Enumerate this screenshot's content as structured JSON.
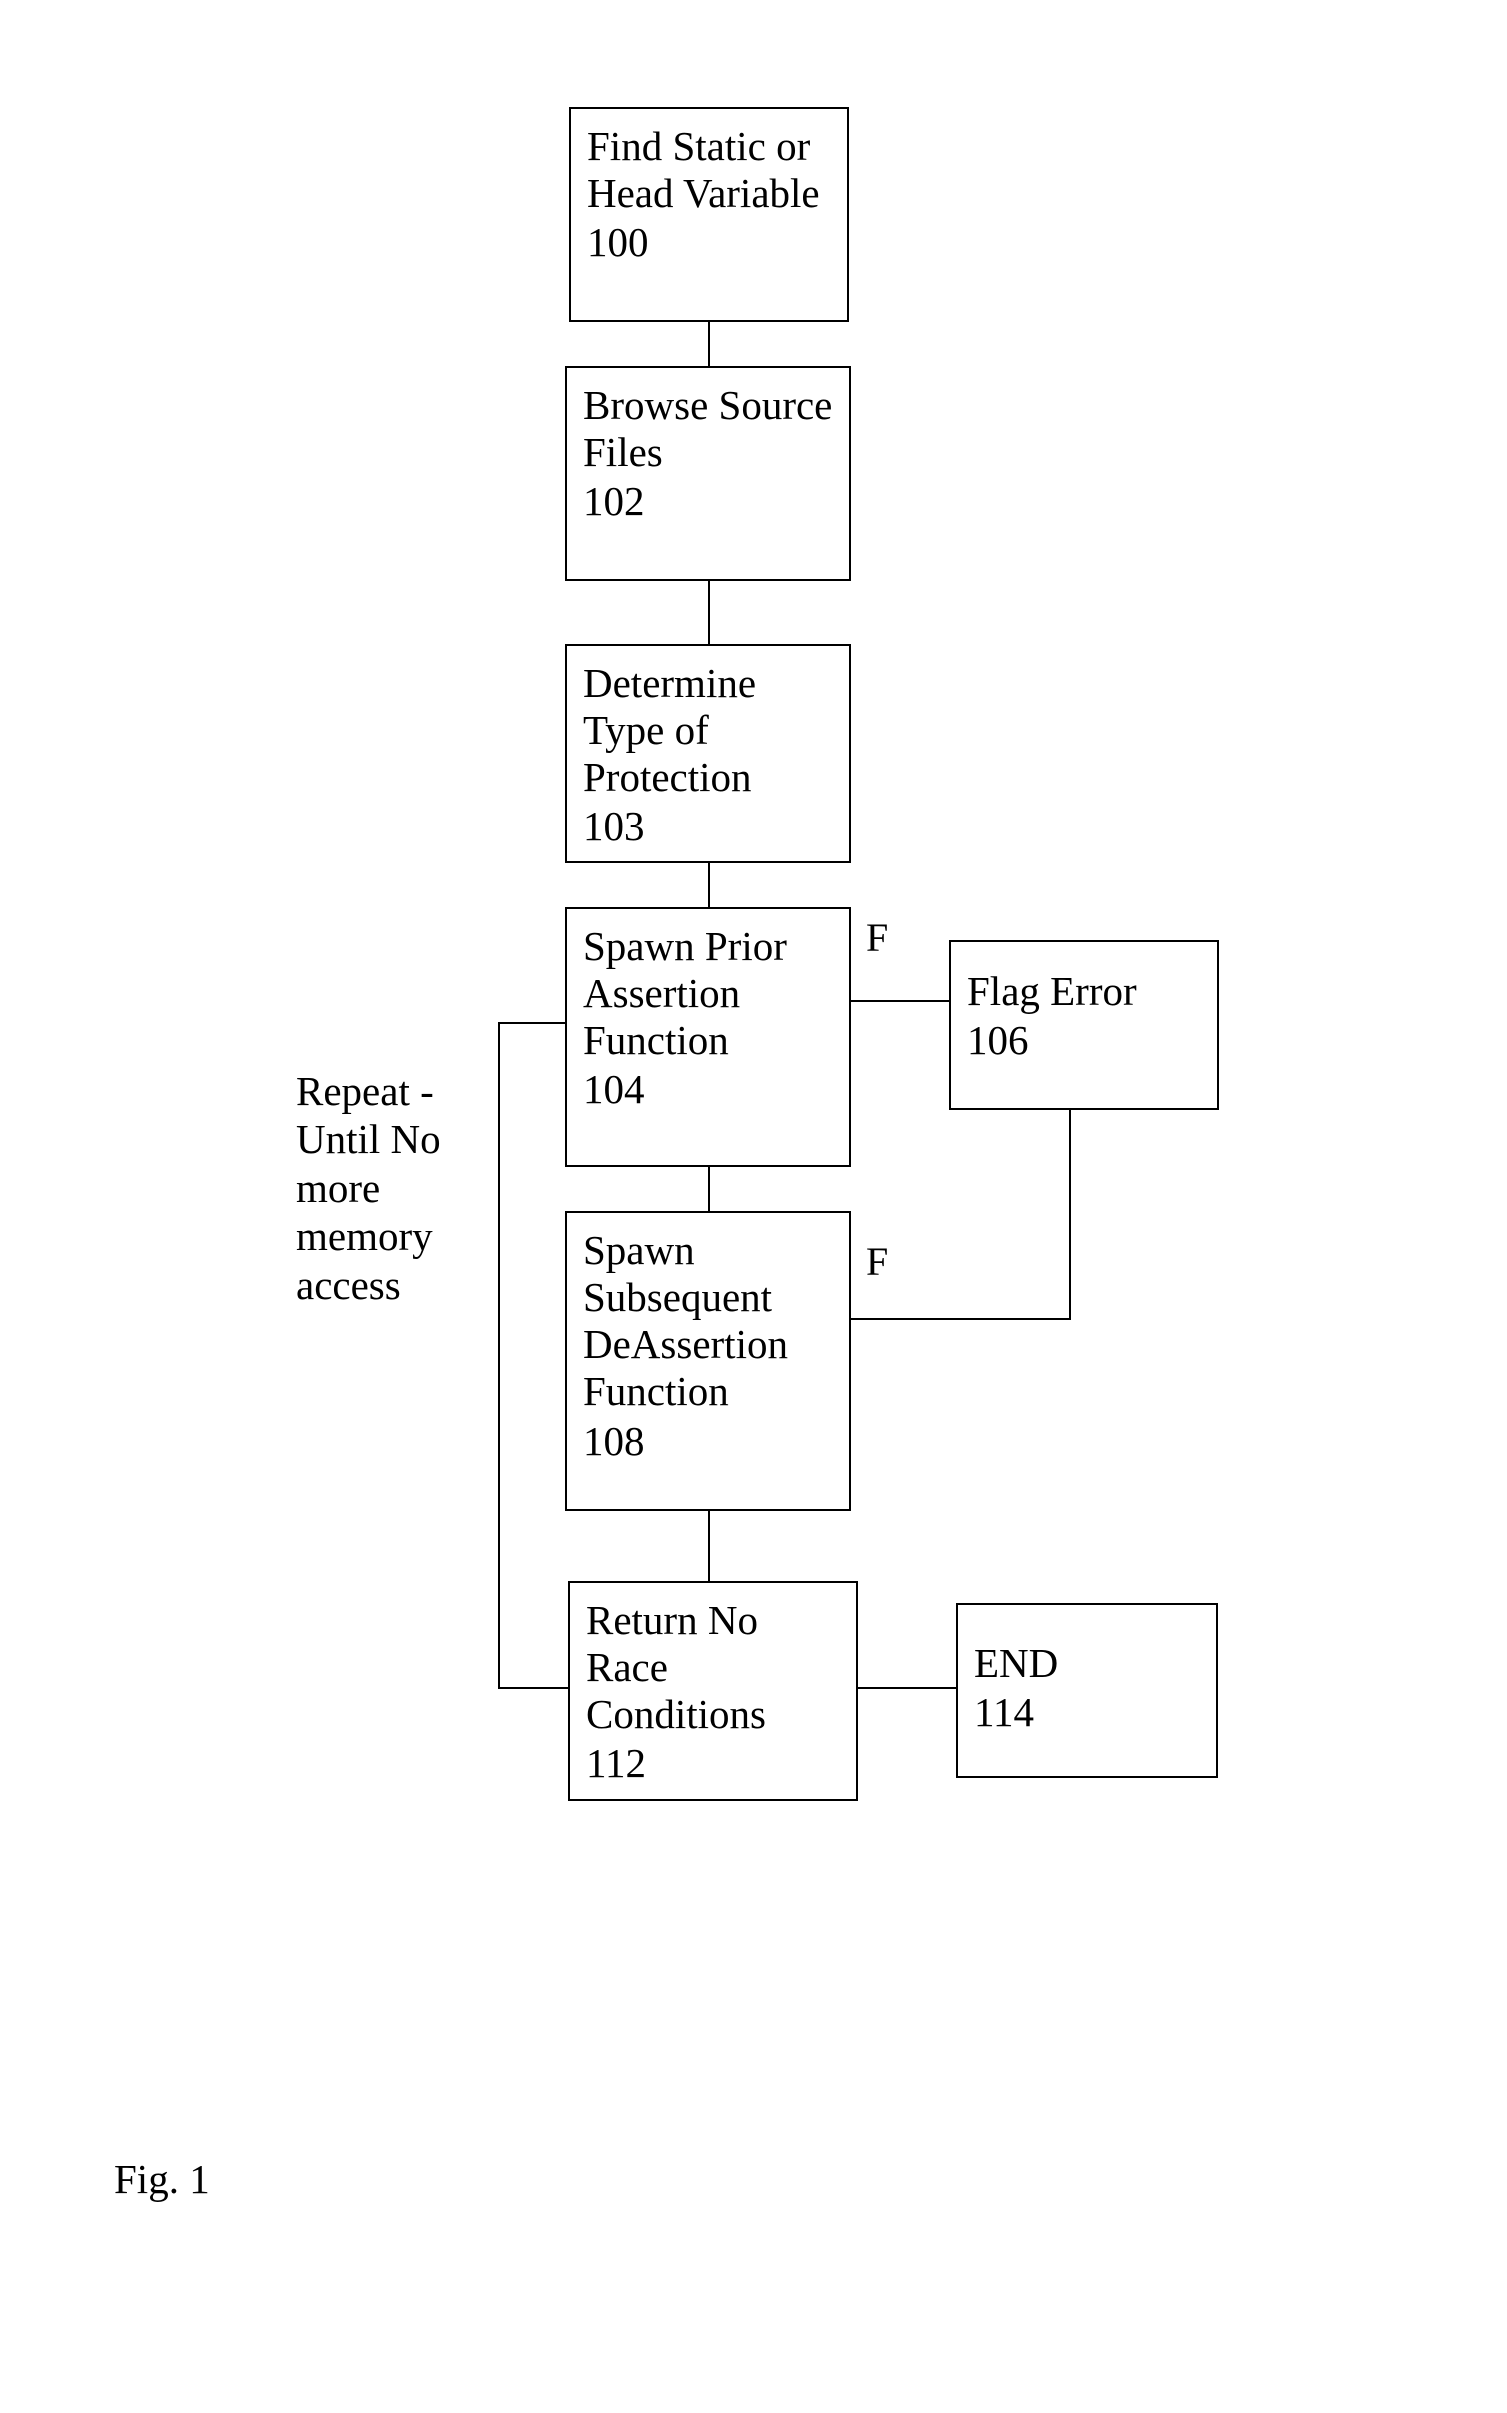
{
  "figure_label": "Fig. 1",
  "boxes": {
    "b100": {
      "label": "Find Static or Head Variable",
      "num": "100"
    },
    "b102": {
      "label": "Browse Source Files",
      "num": "102"
    },
    "b103": {
      "label": "Determine Type of Protection",
      "num": "103"
    },
    "b104": {
      "label": "Spawn Prior Assertion Function",
      "num": "104"
    },
    "b106": {
      "label": "Flag Error",
      "num": "106"
    },
    "b108": {
      "label": "Spawn Subsequent DeAssertion Function",
      "num": "108"
    },
    "b112": {
      "label": "Return No Race Conditions",
      "num": "112"
    },
    "b114": {
      "label": "END",
      "num": "114"
    }
  },
  "loop_text": "Repeat - Until No more memory access",
  "edge_labels": {
    "e104_f": "F",
    "e108_f": "F"
  },
  "chart_data": {
    "type": "flowchart",
    "title": "Fig. 1",
    "nodes": [
      {
        "id": "100",
        "label": "Find Static or Head Variable"
      },
      {
        "id": "102",
        "label": "Browse Source Files"
      },
      {
        "id": "103",
        "label": "Determine Type of Protection"
      },
      {
        "id": "104",
        "label": "Spawn Prior Assertion Function"
      },
      {
        "id": "106",
        "label": "Flag Error"
      },
      {
        "id": "108",
        "label": "Spawn Subsequent DeAssertion Function"
      },
      {
        "id": "112",
        "label": "Return No Race Conditions"
      },
      {
        "id": "114",
        "label": "END"
      }
    ],
    "edges": [
      {
        "from": "100",
        "to": "102"
      },
      {
        "from": "102",
        "to": "103"
      },
      {
        "from": "103",
        "to": "104"
      },
      {
        "from": "104",
        "to": "106",
        "label": "F"
      },
      {
        "from": "104",
        "to": "108"
      },
      {
        "from": "108",
        "to": "106",
        "label": "F"
      },
      {
        "from": "106",
        "to": "114"
      },
      {
        "from": "108",
        "to": "112"
      },
      {
        "from": "112",
        "to": "114"
      },
      {
        "from": "112",
        "to": "104",
        "label": "Repeat - Until No more memory access",
        "kind": "loop-back"
      }
    ]
  }
}
